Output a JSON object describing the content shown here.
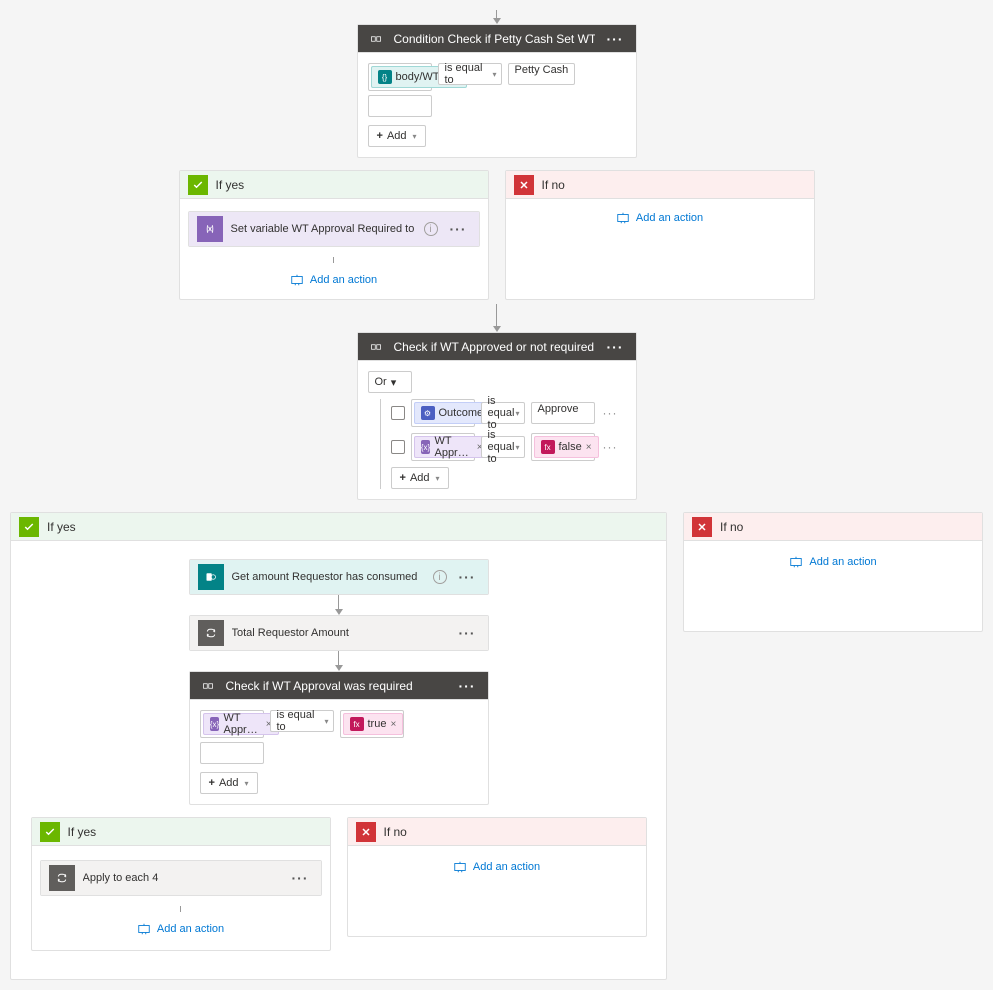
{
  "cond1": {
    "title": "Condition Check if Petty Cash Set WT Approver not required",
    "token": "body/WT…",
    "op": "is equal to",
    "val": "Petty Cash",
    "addBtn": "Add"
  },
  "branch": {
    "yes": "If yes",
    "no": "If no",
    "addAction": "Add an action"
  },
  "setVar": {
    "title": "Set variable WT Approval Required to False"
  },
  "cond2": {
    "title": "Check if WT Approved or not required",
    "orLabel": "Or",
    "row1": {
      "token": "Outcome",
      "op": "is equal to",
      "val": "Approve"
    },
    "row2": {
      "token": "WT Appr…",
      "op": "is equal to",
      "valToken": "false"
    },
    "addBtn": "Add"
  },
  "getAmount": {
    "title": "Get amount Requestor has consumed"
  },
  "total": {
    "title": "Total Requestor Amount"
  },
  "cond3": {
    "title": "Check if WT Approval was required",
    "token": "WT Appr…",
    "op": "is equal to",
    "valToken": "true",
    "addBtn": "Add"
  },
  "applyEach": {
    "title": "Apply to each 4"
  }
}
